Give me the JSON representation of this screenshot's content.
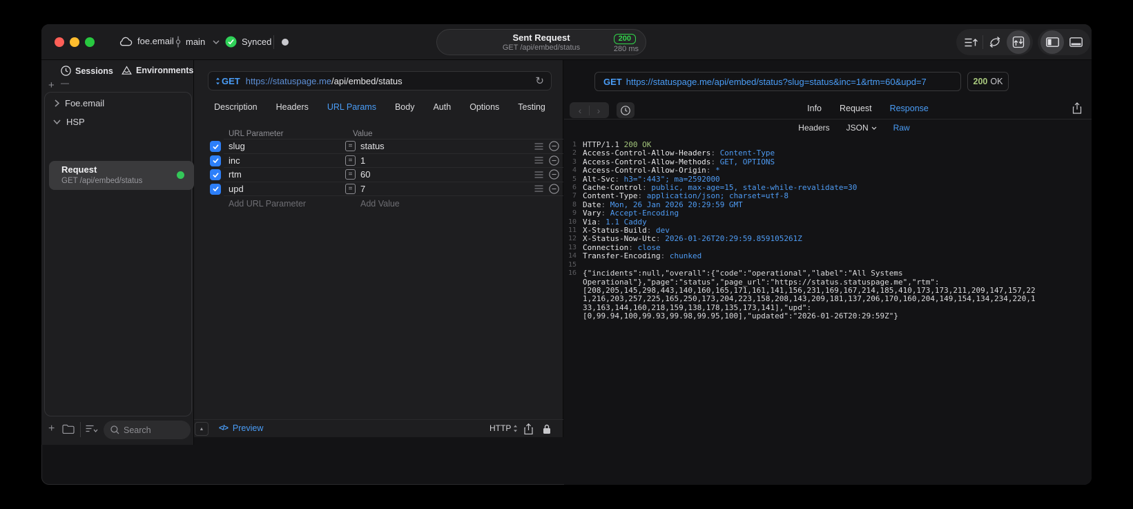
{
  "colors": {
    "accent_blue": "#4A9DF7",
    "success_green": "#32D74B",
    "status_green_text": "#A9C97E",
    "checkbox_blue": "#2D7FF9"
  },
  "titlebar": {
    "project": "foe.email",
    "branch": "main",
    "sync_status": "Synced",
    "request_title": "Sent Request",
    "request_subtitle": "GET /api/embed/status",
    "status_code": "200",
    "duration": "280 ms"
  },
  "sidebar": {
    "tabs": [
      {
        "label": "Sessions"
      },
      {
        "label": "Environments"
      }
    ],
    "add_label": "+",
    "remove_label": "—",
    "tree": [
      {
        "label": "Foe.email"
      },
      {
        "label": "HSP"
      }
    ],
    "selected_request": {
      "title": "Request",
      "subtitle": "GET /api/embed/status"
    },
    "search_placeholder": "Search"
  },
  "request_editor": {
    "method": "GET",
    "url_host": "https://statuspage.me",
    "url_path": "/api/embed/status",
    "tabs": [
      "Description",
      "Headers",
      "URL Params",
      "Body",
      "Auth",
      "Options",
      "Testing"
    ],
    "active_tab": "URL Params",
    "param_table": {
      "columns": [
        "URL Parameter",
        "Value"
      ],
      "rows": [
        {
          "enabled": true,
          "name": "slug",
          "value": "status"
        },
        {
          "enabled": true,
          "name": "inc",
          "value": "1"
        },
        {
          "enabled": true,
          "name": "rtm",
          "value": "60"
        },
        {
          "enabled": true,
          "name": "upd",
          "value": "7"
        }
      ],
      "add_name_placeholder": "Add URL Parameter",
      "add_value_placeholder": "Add Value"
    },
    "footer": {
      "preview_label": "Preview",
      "code_glyph": "</>",
      "protocol": "HTTP"
    }
  },
  "response_panel": {
    "request_line": "GET https://statuspage.me/api/embed/status?slug=status&inc=1&rtm=60&upd=7",
    "status_code": "200",
    "status_text": "OK",
    "tabs": [
      "Info",
      "Request",
      "Response"
    ],
    "active_tab": "Response",
    "view_tabs": [
      "Headers",
      "JSON",
      "Raw"
    ],
    "active_view": "Raw",
    "lines": [
      {
        "num": "1",
        "segments": [
          {
            "style": "plain",
            "text": "HTTP/1.1 "
          },
          {
            "style": "green",
            "text": "200 OK"
          }
        ]
      },
      {
        "num": "2",
        "segments": [
          {
            "style": "name",
            "text": "Access-Control-Allow-Headers"
          },
          {
            "style": "punct",
            "text": ": "
          },
          {
            "style": "value",
            "text": "Content-Type"
          }
        ]
      },
      {
        "num": "3",
        "segments": [
          {
            "style": "name",
            "text": "Access-Control-Allow-Methods"
          },
          {
            "style": "punct",
            "text": ": "
          },
          {
            "style": "value",
            "text": "GET, OPTIONS"
          }
        ]
      },
      {
        "num": "4",
        "segments": [
          {
            "style": "name",
            "text": "Access-Control-Allow-Origin"
          },
          {
            "style": "punct",
            "text": ": "
          },
          {
            "style": "value",
            "text": "*"
          }
        ]
      },
      {
        "num": "5",
        "segments": [
          {
            "style": "name",
            "text": "Alt-Svc"
          },
          {
            "style": "punct",
            "text": ": "
          },
          {
            "style": "value",
            "text": "h3=\":443\"; ma=2592000"
          }
        ]
      },
      {
        "num": "6",
        "segments": [
          {
            "style": "name",
            "text": "Cache-Control"
          },
          {
            "style": "punct",
            "text": ": "
          },
          {
            "style": "value",
            "text": "public, max-age=15, stale-while-revalidate=30"
          }
        ]
      },
      {
        "num": "7",
        "segments": [
          {
            "style": "name",
            "text": "Content-Type"
          },
          {
            "style": "punct",
            "text": ": "
          },
          {
            "style": "value",
            "text": "application/json; charset=utf-8"
          }
        ]
      },
      {
        "num": "8",
        "segments": [
          {
            "style": "name",
            "text": "Date"
          },
          {
            "style": "punct",
            "text": ": "
          },
          {
            "style": "value",
            "text": "Mon, 26 Jan 2026 20:29:59 GMT"
          }
        ]
      },
      {
        "num": "9",
        "segments": [
          {
            "style": "name",
            "text": "Vary"
          },
          {
            "style": "punct",
            "text": ": "
          },
          {
            "style": "value",
            "text": "Accept-Encoding"
          }
        ]
      },
      {
        "num": "10",
        "segments": [
          {
            "style": "name",
            "text": "Via"
          },
          {
            "style": "punct",
            "text": ": "
          },
          {
            "style": "value",
            "text": "1.1 Caddy"
          }
        ]
      },
      {
        "num": "11",
        "segments": [
          {
            "style": "name",
            "text": "X-Status-Build"
          },
          {
            "style": "punct",
            "text": ": "
          },
          {
            "style": "value",
            "text": "dev"
          }
        ]
      },
      {
        "num": "12",
        "segments": [
          {
            "style": "name",
            "text": "X-Status-Now-Utc"
          },
          {
            "style": "punct",
            "text": ": "
          },
          {
            "style": "value",
            "text": "2026-01-26T20:29:59.859105261Z"
          }
        ]
      },
      {
        "num": "13",
        "segments": [
          {
            "style": "name",
            "text": "Connection"
          },
          {
            "style": "punct",
            "text": ": "
          },
          {
            "style": "value",
            "text": "close"
          }
        ]
      },
      {
        "num": "14",
        "segments": [
          {
            "style": "name",
            "text": "Transfer-Encoding"
          },
          {
            "style": "punct",
            "text": ": "
          },
          {
            "style": "value",
            "text": "chunked"
          }
        ]
      },
      {
        "num": "15",
        "segments": []
      },
      {
        "num": "16",
        "segments": [
          {
            "style": "plain",
            "text": "{\"incidents\":null,\"overall\":{\"code\":\"operational\",\"label\":\"All Systems Operational\"},\"page\":\"status\",\"page_url\":\"https://status.statuspage.me\",\"rtm\":[208,205,145,298,443,140,160,165,171,161,141,156,231,169,167,214,185,410,173,173,211,209,147,157,221,216,203,257,225,165,250,173,204,223,158,208,143,209,181,137,206,170,160,204,149,154,134,234,220,133,163,144,160,218,159,138,178,135,173,141],\"upd\":[0,99.94,100,99.93,99.98,99.95,100],\"updated\":\"2026-01-26T20:29:59Z\"}"
          }
        ]
      }
    ]
  }
}
